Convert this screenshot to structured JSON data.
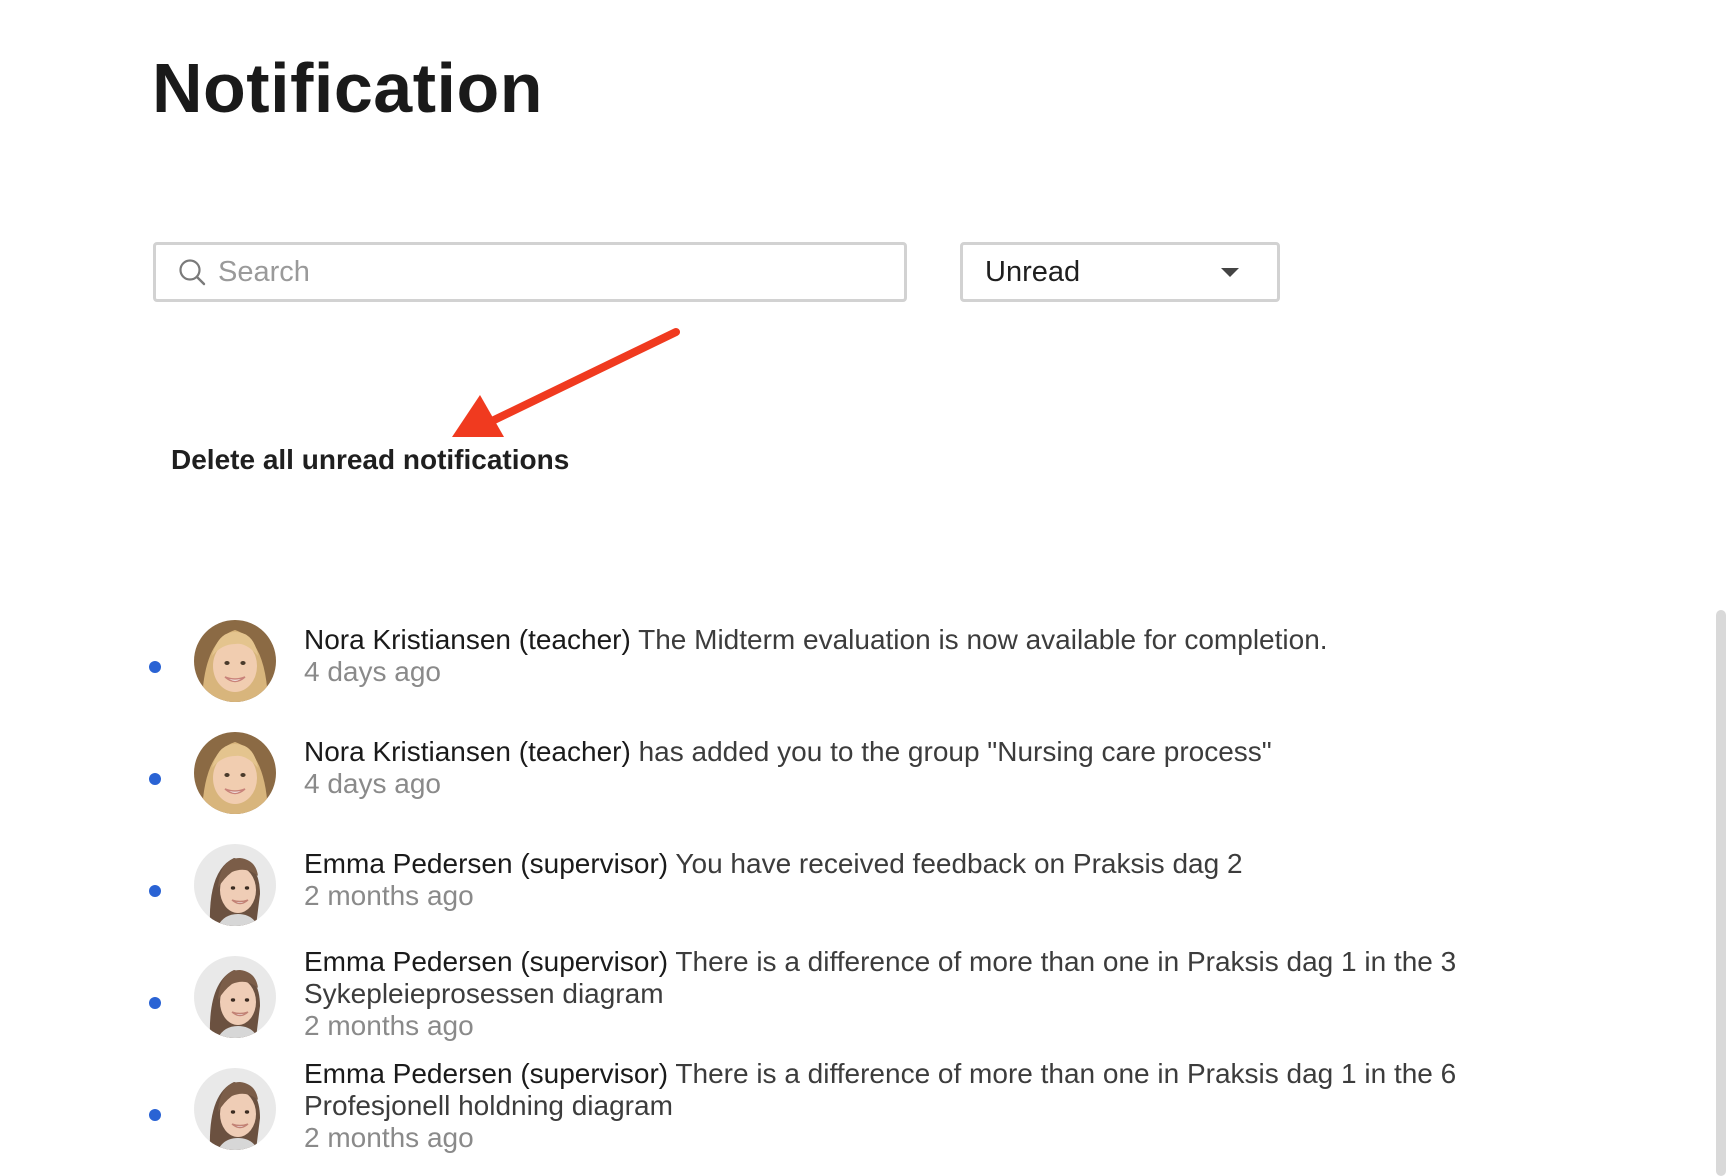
{
  "page": {
    "title": "Notification"
  },
  "search": {
    "placeholder": "Search",
    "value": ""
  },
  "filter": {
    "selected": "Unread"
  },
  "actions": {
    "delete_all_label": "Delete all unread notifications"
  },
  "colors": {
    "unread_dot": "#2a63d4",
    "annotation_arrow": "#f03a1f",
    "input_border": "#d2d2d2"
  },
  "notifications": [
    {
      "author": "Nora Kristiansen (teacher)",
      "message": "The Midterm evaluation is now available for completion.",
      "time": "4 days ago",
      "avatar": "nora-avatar",
      "unread": true
    },
    {
      "author": "Nora Kristiansen (teacher)",
      "message": "has added you to the group \"Nursing care process\"",
      "time": "4 days ago",
      "avatar": "nora-avatar",
      "unread": true
    },
    {
      "author": "Emma Pedersen (supervisor)",
      "message": "You have received feedback on Praksis dag 2",
      "time": "2 months ago",
      "avatar": "emma-avatar",
      "unread": true
    },
    {
      "author": "Emma Pedersen (supervisor)",
      "message": "There is a difference of more than one in Praksis dag 1 in the 3 Sykepleieprosessen diagram",
      "time": "2 months ago",
      "avatar": "emma-avatar",
      "unread": true
    },
    {
      "author": "Emma Pedersen (supervisor)",
      "message": "There is a difference of more than one in Praksis dag 1 in the 6 Profesjonell holdning diagram",
      "time": "2 months ago",
      "avatar": "emma-avatar",
      "unread": true
    }
  ]
}
